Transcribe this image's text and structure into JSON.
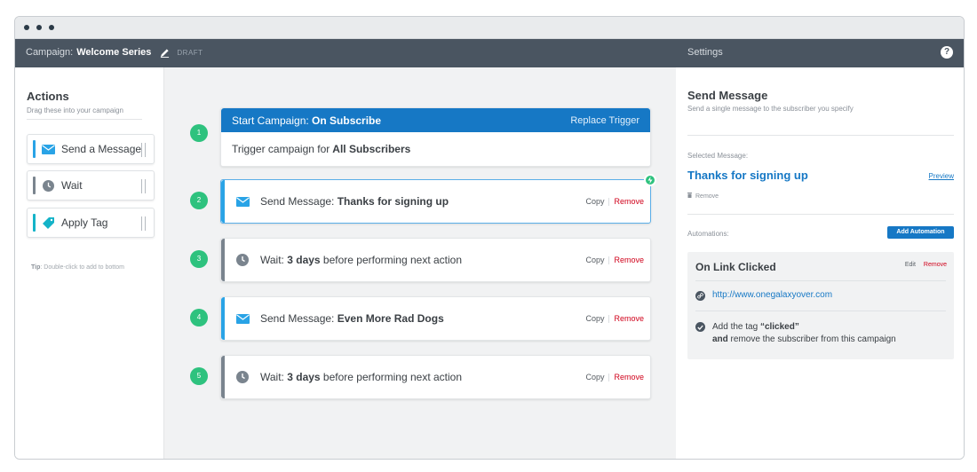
{
  "topbar": {
    "campaign_label": "Campaign:",
    "campaign_name": "Welcome Series",
    "status": "DRAFT",
    "settings": "Settings",
    "help": "?"
  },
  "actions": {
    "title": "Actions",
    "subtitle": "Drag these into your campaign",
    "items": [
      {
        "label": "Send a Message",
        "icon": "envelope-icon",
        "color": "#29a3e6"
      },
      {
        "label": "Wait",
        "icon": "clock-icon",
        "color": "#7a848e"
      },
      {
        "label": "Apply Tag",
        "icon": "tag-icon",
        "color": "#14b3c8"
      }
    ],
    "tip_bold": "Tip",
    "tip_text": ": Double-click to add to bottom"
  },
  "flow": {
    "trigger": {
      "step": "1",
      "head_prefix": "Start Campaign: ",
      "head_bold": "On Subscribe",
      "replace": "Replace Trigger",
      "body_prefix": "Trigger campaign for ",
      "body_bold": "All Subscribers"
    },
    "steps": [
      {
        "step": "2",
        "prefix": "Send Message: ",
        "bold": "Thanks for signing up",
        "suffix": "",
        "copy": "Copy",
        "remove": "Remove"
      },
      {
        "step": "3",
        "prefix": "Wait: ",
        "bold": "3 days",
        "suffix": " before performing next action",
        "copy": "Copy",
        "remove": "Remove"
      },
      {
        "step": "4",
        "prefix": "Send Message: ",
        "bold": "Even More Rad Dogs",
        "suffix": "",
        "copy": "Copy",
        "remove": "Remove"
      },
      {
        "step": "5",
        "prefix": "Wait: ",
        "bold": "3 days",
        "suffix": " before performing next action",
        "copy": "Copy",
        "remove": "Remove"
      }
    ]
  },
  "settings": {
    "title": "Send Message",
    "subtitle": "Send a single message to the subscriber you specify",
    "selected_label": "Selected Message:",
    "selected_message": "Thanks for signing up",
    "preview": "Preview",
    "remove": "Remove",
    "automations_label": "Automations:",
    "add_automation": "Add Automation",
    "automation": {
      "title": "On Link Clicked",
      "edit": "Edit",
      "remove": "Remove",
      "url": "http://www.onegalaxyover.com",
      "action_prefix": "Add the tag ",
      "action_tag": "“clicked”",
      "action_and": "and",
      "action_suffix": " remove the subscriber from this campaign"
    }
  },
  "colors": {
    "accent": "#1678c5",
    "success": "#2ec27e",
    "danger": "#d0021b",
    "topbar": "#4a5561"
  }
}
